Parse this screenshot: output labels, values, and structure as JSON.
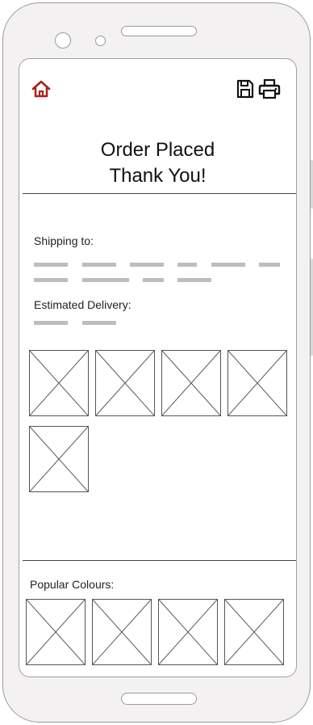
{
  "header": {
    "home_icon": "home-icon",
    "save_icon": "save-icon",
    "print_icon": "print-icon",
    "title_line1": "Order Placed",
    "title_line2": "Thank You!"
  },
  "shipping": {
    "label": "Shipping to:"
  },
  "delivery": {
    "label": "Estimated Delivery:"
  },
  "order_items": {
    "count": 5
  },
  "popular": {
    "label": "Popular Colours:",
    "count": 4
  },
  "colors": {
    "accent": "#a8231d",
    "frame": "#f3f1f1",
    "placeholder_line": "#bdbdbd"
  }
}
